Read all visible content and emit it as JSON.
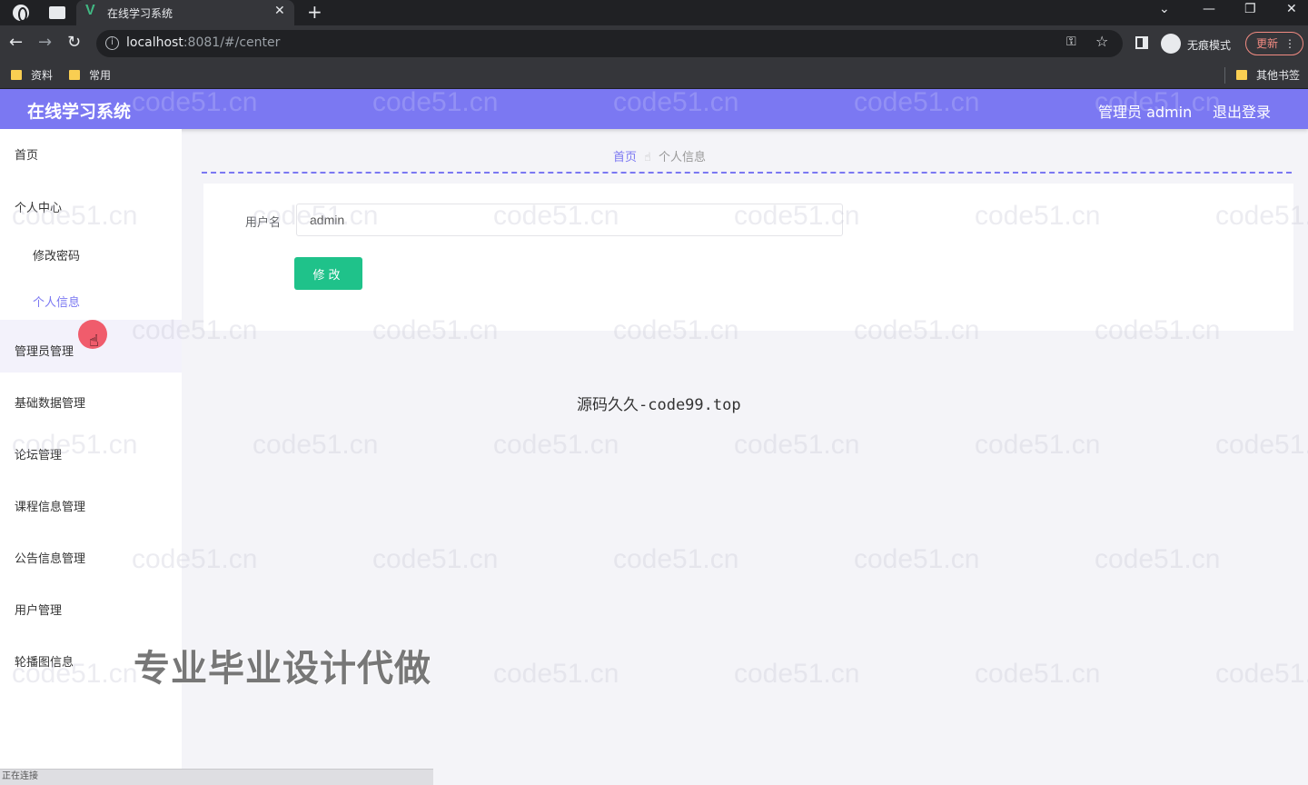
{
  "browser": {
    "tab_title": "在线学习系统",
    "url_host": "localhost",
    "url_rest": ":8081/#/center",
    "incognito_label": "无痕模式",
    "update_label": "更新",
    "bookmarks": [
      "资料",
      "常用"
    ],
    "other_bookmarks": "其他书签"
  },
  "header": {
    "app_title": "在线学习系统",
    "user_label": "管理员 admin",
    "logout_label": "退出登录",
    "accent_color": "#7b78f2"
  },
  "sidebar": {
    "items": [
      {
        "label": "首页"
      },
      {
        "label": "个人中心"
      },
      {
        "label": "修改密码"
      },
      {
        "label": "个人信息"
      },
      {
        "label": "管理员管理"
      },
      {
        "label": "基础数据管理"
      },
      {
        "label": "论坛管理"
      },
      {
        "label": "课程信息管理"
      },
      {
        "label": "公告信息管理"
      },
      {
        "label": "用户管理"
      },
      {
        "label": "轮播图信息"
      }
    ]
  },
  "breadcrumb": {
    "home": "首页",
    "current": "个人信息"
  },
  "form": {
    "username_label": "用户名",
    "username_value": "admin",
    "submit_label": "修改",
    "submit_color": "#1fc28a"
  },
  "overlays": {
    "watermark": "code51.cn",
    "center_note": "源码久久-code99.top",
    "big_text": "专业毕业设计代做",
    "status_text": "正在连接"
  }
}
